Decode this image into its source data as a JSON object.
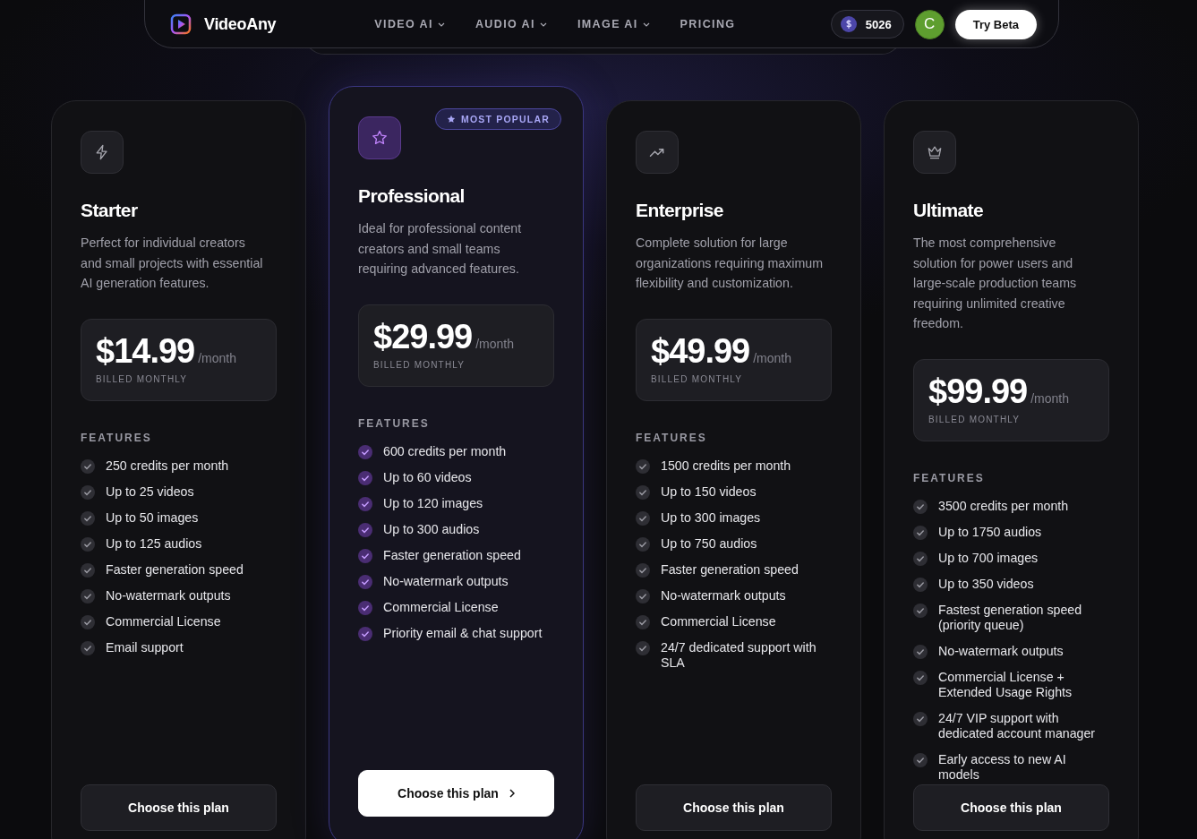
{
  "header": {
    "brand": "VideoAny",
    "nav": [
      {
        "label": "VIDEO AI",
        "has_menu": true
      },
      {
        "label": "AUDIO AI",
        "has_menu": true
      },
      {
        "label": "IMAGE AI",
        "has_menu": true
      },
      {
        "label": "PRICING",
        "has_menu": false
      }
    ],
    "credits": "5026",
    "avatar_initial": "C",
    "cta": "Try Beta"
  },
  "plans": [
    {
      "kind": "bolt",
      "featured": false,
      "name": "Starter",
      "description": "Perfect for individual creators and small projects with essential AI generation features.",
      "price": "$14.99",
      "period": "/month",
      "billing": "BILLED MONTHLY",
      "features_label": "FEATURES",
      "features": [
        "250 credits per month",
        "Up to 25 videos",
        "Up to 50 images",
        "Up to 125 audios",
        "Faster generation speed",
        "No-watermark outputs",
        "Commercial License",
        "Email support"
      ],
      "button": "Choose this plan"
    },
    {
      "kind": "star",
      "featured": true,
      "badge": "MOST POPULAR",
      "name": "Professional",
      "description": "Ideal for professional content creators and small teams requiring advanced features.",
      "price": "$29.99",
      "period": "/month",
      "billing": "BILLED MONTHLY",
      "features_label": "FEATURES",
      "features": [
        "600 credits per month",
        "Up to 60 videos",
        "Up to 120 images",
        "Up to 300 audios",
        "Faster generation speed",
        "No-watermark outputs",
        "Commercial License",
        "Priority email & chat support"
      ],
      "button": "Choose this plan"
    },
    {
      "kind": "trend",
      "featured": false,
      "name": "Enterprise",
      "description": "Complete solution for large organizations requiring maximum flexibility and customization.",
      "price": "$49.99",
      "period": "/month",
      "billing": "BILLED MONTHLY",
      "features_label": "FEATURES",
      "features": [
        "1500 credits per month",
        "Up to 150 videos",
        "Up to 300 images",
        "Up to 750 audios",
        "Faster generation speed",
        "No-watermark outputs",
        "Commercial License",
        "24/7 dedicated support with SLA"
      ],
      "button": "Choose this plan"
    },
    {
      "kind": "crown",
      "featured": false,
      "name": "Ultimate",
      "description": "The most comprehensive solution for power users and large-scale production teams requiring unlimited creative freedom.",
      "price": "$99.99",
      "period": "/month",
      "billing": "BILLED MONTHLY",
      "features_label": "FEATURES",
      "features": [
        "3500 credits per month",
        "Up to 1750 audios",
        "Up to 700 images",
        "Up to 350 videos",
        "Fastest generation speed (priority queue)",
        "No-watermark outputs",
        "Commercial License + Extended Usage Rights",
        "24/7 VIP support with dedicated account manager",
        "Early access to new AI models"
      ],
      "button": "Choose this plan"
    }
  ]
}
